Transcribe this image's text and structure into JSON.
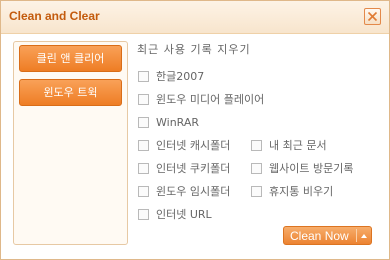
{
  "window": {
    "title": "Clean and Clear"
  },
  "sidebar": {
    "items": [
      {
        "label": "클린 앤 클리어"
      },
      {
        "label": "윈도우 트윅"
      }
    ]
  },
  "section": {
    "title": "최근 사용 기록 지우기"
  },
  "options": {
    "hangul": "한글2007",
    "media_player": "윈도우 미디어 플레이어",
    "winrar": "WinRAR",
    "ie_cache": "인터넷 캐시폴더",
    "recent_docs": "내 최근 문서",
    "ie_cookies": "인터넷 쿠키폴더",
    "web_history": "웹사이트 방문기록",
    "win_temp": "윈도우 임시폴더",
    "recycle_bin": "휴지통 비우기",
    "ie_url": "인터넷 URL"
  },
  "actions": {
    "clean_now": "Clean Now"
  },
  "colors": {
    "accent": "#ee7d24",
    "title": "#c35b0d",
    "border": "#dfb88a"
  }
}
